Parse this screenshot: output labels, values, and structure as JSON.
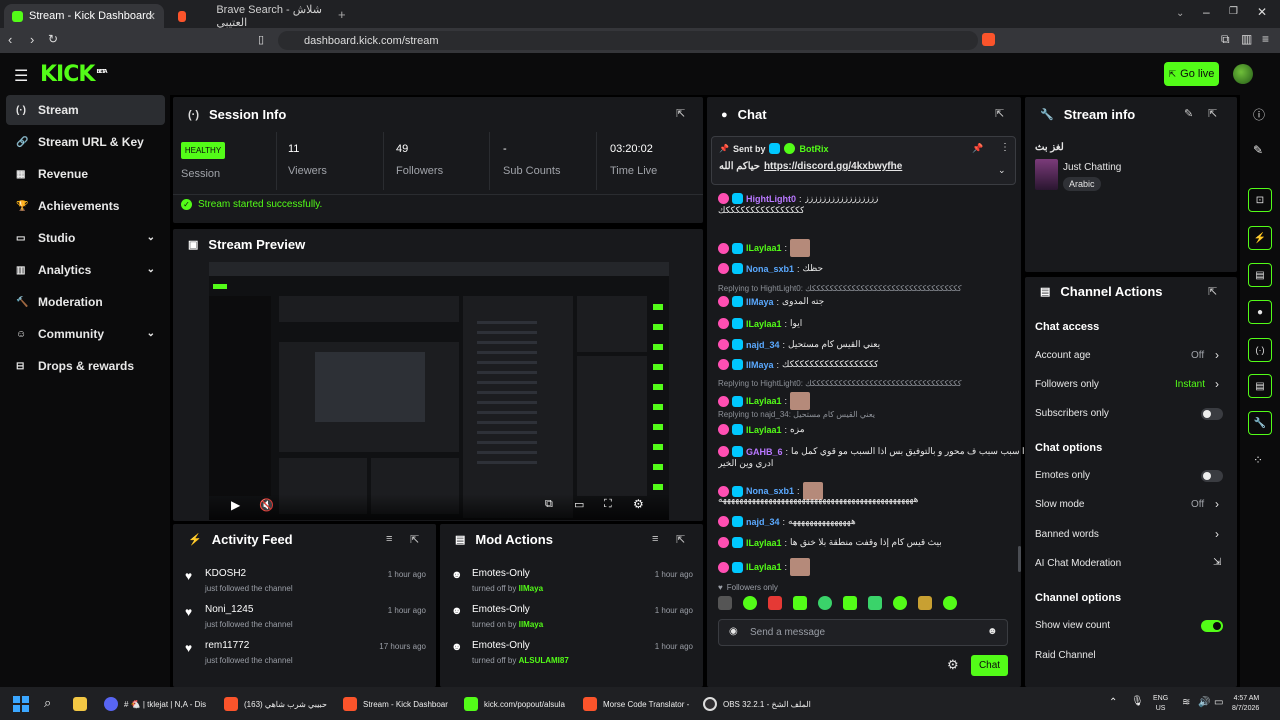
{
  "browser": {
    "tabs": [
      {
        "title": "Stream - Kick Dashboard",
        "active": true
      },
      {
        "title": "Brave Search - شلاش العتيبي",
        "active": false
      }
    ],
    "url": "dashboard.kick.com/stream"
  },
  "header": {
    "logo": "KICK",
    "logo_tag": "BETA",
    "go_live": "Go live"
  },
  "sidebar": {
    "items": [
      {
        "label": "Stream",
        "icon": "stream-icon",
        "active": true
      },
      {
        "label": "Stream URL & Key",
        "icon": "link-icon"
      },
      {
        "label": "Revenue",
        "icon": "revenue-icon"
      },
      {
        "label": "Achievements",
        "icon": "trophy-icon"
      },
      {
        "label": "Studio",
        "icon": "studio-icon",
        "expandable": true
      },
      {
        "label": "Analytics",
        "icon": "analytics-icon",
        "expandable": true
      },
      {
        "label": "Moderation",
        "icon": "moderation-icon"
      },
      {
        "label": "Community",
        "icon": "community-icon",
        "expandable": true
      },
      {
        "label": "Drops & rewards",
        "icon": "drops-icon"
      }
    ]
  },
  "session": {
    "title": "Session Info",
    "status": "HEALTHY",
    "status_label": "Session",
    "stats": [
      {
        "value": "11",
        "label": "Viewers"
      },
      {
        "value": "49",
        "label": "Followers"
      },
      {
        "value": "-",
        "label": "Sub Counts"
      },
      {
        "value": "03:20:02",
        "label": "Time Live"
      }
    ],
    "message": "Stream started successfully."
  },
  "preview": {
    "title": "Stream Preview"
  },
  "activity": {
    "title": "Activity Feed",
    "items": [
      {
        "name": "KDOSH2",
        "sub": "just followed the channel",
        "time": "1 hour ago"
      },
      {
        "name": "Noni_1245",
        "sub": "just followed the channel",
        "time": "1 hour ago"
      },
      {
        "name": "rem11772",
        "sub": "just followed the channel",
        "time": "17 hours ago"
      }
    ]
  },
  "mod_actions": {
    "title": "Mod Actions",
    "items": [
      {
        "action": "Emotes-Only",
        "sub": "turned off by",
        "user": "llMaya",
        "user_color": "#53fc18",
        "time": "1 hour ago"
      },
      {
        "action": "Emotes-Only",
        "sub": "turned on by",
        "user": "llMaya",
        "user_color": "#53fc18",
        "time": "1 hour ago"
      },
      {
        "action": "Emotes-Only",
        "sub": "turned off by",
        "user": "ALSULAMI87",
        "user_color": "#53fc18",
        "time": "1 hour ago"
      }
    ]
  },
  "chat": {
    "title": "Chat",
    "pinned": {
      "sent_by": "Sent by",
      "author": "BotRix",
      "text": "حياكم الله",
      "link": "https://discord.gg/4kxbwyfhe"
    },
    "messages": [
      {
        "user": "HightLight0",
        "color": "#b978ff",
        "text": "ززززززززززززززززز",
        "cont": "ككككككككككككككككك"
      },
      {
        "user": "lLaylaa1",
        "color": "#53fc18",
        "text": ""
      },
      {
        "user": "Nona_sxb1",
        "color": "#5aa9ff",
        "text": "حظك"
      },
      {
        "reply": "Replying to HightLight0: ككككككككككككككككككككككككككككككككككك"
      },
      {
        "user": "llMaya",
        "color": "#5aa9ff",
        "text": "جته المدوى"
      },
      {
        "user": "lLaylaa1",
        "color": "#53fc18",
        "text": "ايوا"
      },
      {
        "user": "najd_34",
        "color": "#5aa9ff",
        "text": "يعني القيس كام مستحيل"
      },
      {
        "user": "llMaya",
        "color": "#5aa9ff",
        "text": "ككككككككككككككككككك"
      },
      {
        "reply": "Replying to HightLight0: ككككككككككككككككككككككككككككككككككك"
      },
      {
        "user": "lLaylaa1",
        "color": "#53fc18",
        "text": ""
      },
      {
        "reply": "Replying to najd_34: يعني القيس كام مستحيل"
      },
      {
        "user": "lLaylaa1",
        "color": "#53fc18",
        "text": "مزه"
      },
      {
        "user": "GAHB_6",
        "color": "#b978ff",
        "text": "اذا سبب سبب ف محور و بالتوفيق بس اذا السبب مو قوي كمل ما",
        "cont": "ادري وين الخير"
      },
      {
        "user": "Nona_sxb1",
        "color": "#5aa9ff",
        "text": "",
        "cont": "هههههههههههههههههههههههههههههههههههههههههههههههه"
      },
      {
        "user": "najd_34",
        "color": "#5aa9ff",
        "text": "هههههههههههههههه"
      },
      {
        "user": "lLaylaa1",
        "color": "#53fc18",
        "text": "بيث قيس كام إذا وقفت منطقة بلا خنق ها"
      },
      {
        "user": "lLaylaa1",
        "color": "#53fc18",
        "text": ""
      }
    ],
    "followers_only": "Followers only",
    "placeholder": "Send a message",
    "send": "Chat"
  },
  "stream_info": {
    "title": "Stream info",
    "stream_title": "لغز بث",
    "category": "Just Chatting",
    "tag": "Arabic"
  },
  "channel_actions": {
    "title": "Channel Actions",
    "sections": [
      {
        "heading": "Chat access",
        "rows": [
          {
            "label": "Account age",
            "value": "Off",
            "type": "nav"
          },
          {
            "label": "Followers only",
            "value": "Instant",
            "type": "nav",
            "value_color": "#53fc18"
          },
          {
            "label": "Subscribers only",
            "type": "toggle",
            "on": false
          }
        ]
      },
      {
        "heading": "Chat options",
        "rows": [
          {
            "label": "Emotes only",
            "type": "toggle",
            "on": false
          },
          {
            "label": "Slow mode",
            "value": "Off",
            "type": "nav"
          },
          {
            "label": "Banned words",
            "type": "nav"
          },
          {
            "label": "AI Chat Moderation",
            "type": "ext"
          }
        ]
      },
      {
        "heading": "Channel options",
        "rows": [
          {
            "label": "Show view count",
            "type": "toggle",
            "on": true
          },
          {
            "label": "Raid Channel",
            "type": "plain"
          }
        ]
      }
    ]
  },
  "taskbar": {
    "items": [
      {
        "label": "# 🐔 | tklejat | N,A - Dis"
      },
      {
        "label": "(163) حبيبي شرب شاهي"
      },
      {
        "label": "Stream - Kick Dashboar"
      },
      {
        "label": "kick.com/popout/alsula"
      },
      {
        "label": "Morse Code Translator -"
      },
      {
        "label": "OBS 32.2.1 - الملف الشخ"
      }
    ],
    "lang": "ENG",
    "region": "US",
    "time": "4:57 AM",
    "date": "8/7/2026"
  }
}
